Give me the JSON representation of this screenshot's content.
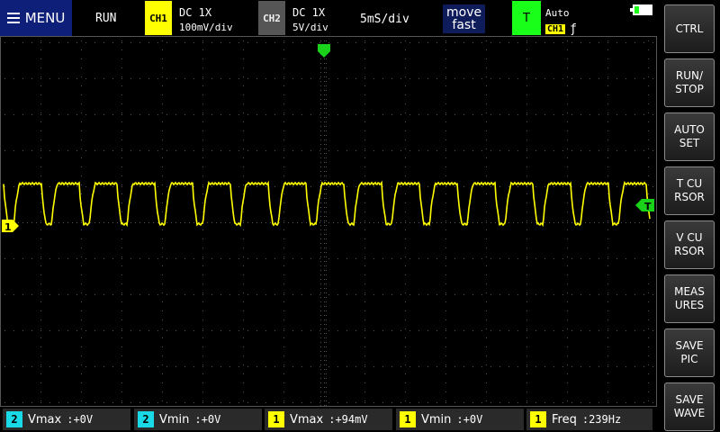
{
  "top": {
    "menu_label": "MENU",
    "run_state": "RUN",
    "ch1": {
      "badge": "CH1",
      "coupling": "DC  1X",
      "scale": "100mV/div",
      "color": "#ffff00"
    },
    "ch2": {
      "badge": "CH2",
      "coupling": "DC  1X",
      "scale": "5V/div",
      "color": "#555555"
    },
    "timebase": "5mS/div",
    "move": {
      "line1": "move",
      "line2": "fast"
    },
    "trigger": {
      "badge": "T",
      "mode": "Auto",
      "source": "CH1",
      "edge": "ƒ"
    }
  },
  "side_buttons": [
    {
      "name": "ctrl-button",
      "label": "CTRL"
    },
    {
      "name": "run-stop-button",
      "label": "RUN/\nSTOP"
    },
    {
      "name": "auto-set-button",
      "label": "AUTO\nSET"
    },
    {
      "name": "t-cursor-button",
      "label": "T CU\nRSOR"
    },
    {
      "name": "v-cursor-button",
      "label": "V CU\nRSOR"
    },
    {
      "name": "measures-button",
      "label": "MEAS\nURES"
    },
    {
      "name": "save-pic-button",
      "label": "SAVE\nPIC"
    },
    {
      "name": "save-wave-button",
      "label": "SAVE\nWAVE"
    }
  ],
  "measurements": [
    {
      "channel": "2",
      "label": "Vmax",
      "value": ":+0V",
      "color": "#19d9e6"
    },
    {
      "channel": "2",
      "label": "Vmin",
      "value": ":+0V",
      "color": "#19d9e6"
    },
    {
      "channel": "1",
      "label": "Vmax",
      "value": ":+94mV",
      "color": "#ffff00"
    },
    {
      "channel": "1",
      "label": "Vmin",
      "value": ":+0V",
      "color": "#ffff00"
    },
    {
      "channel": "1",
      "label": "Freq",
      "value": ":239Hz",
      "color": "#ffff00"
    }
  ],
  "screen": {
    "ch1_marker": "1",
    "trigger_marker": "T",
    "trace_color": "#ffff00",
    "marker_color": "#19d219",
    "grid_color": "#555555"
  }
}
